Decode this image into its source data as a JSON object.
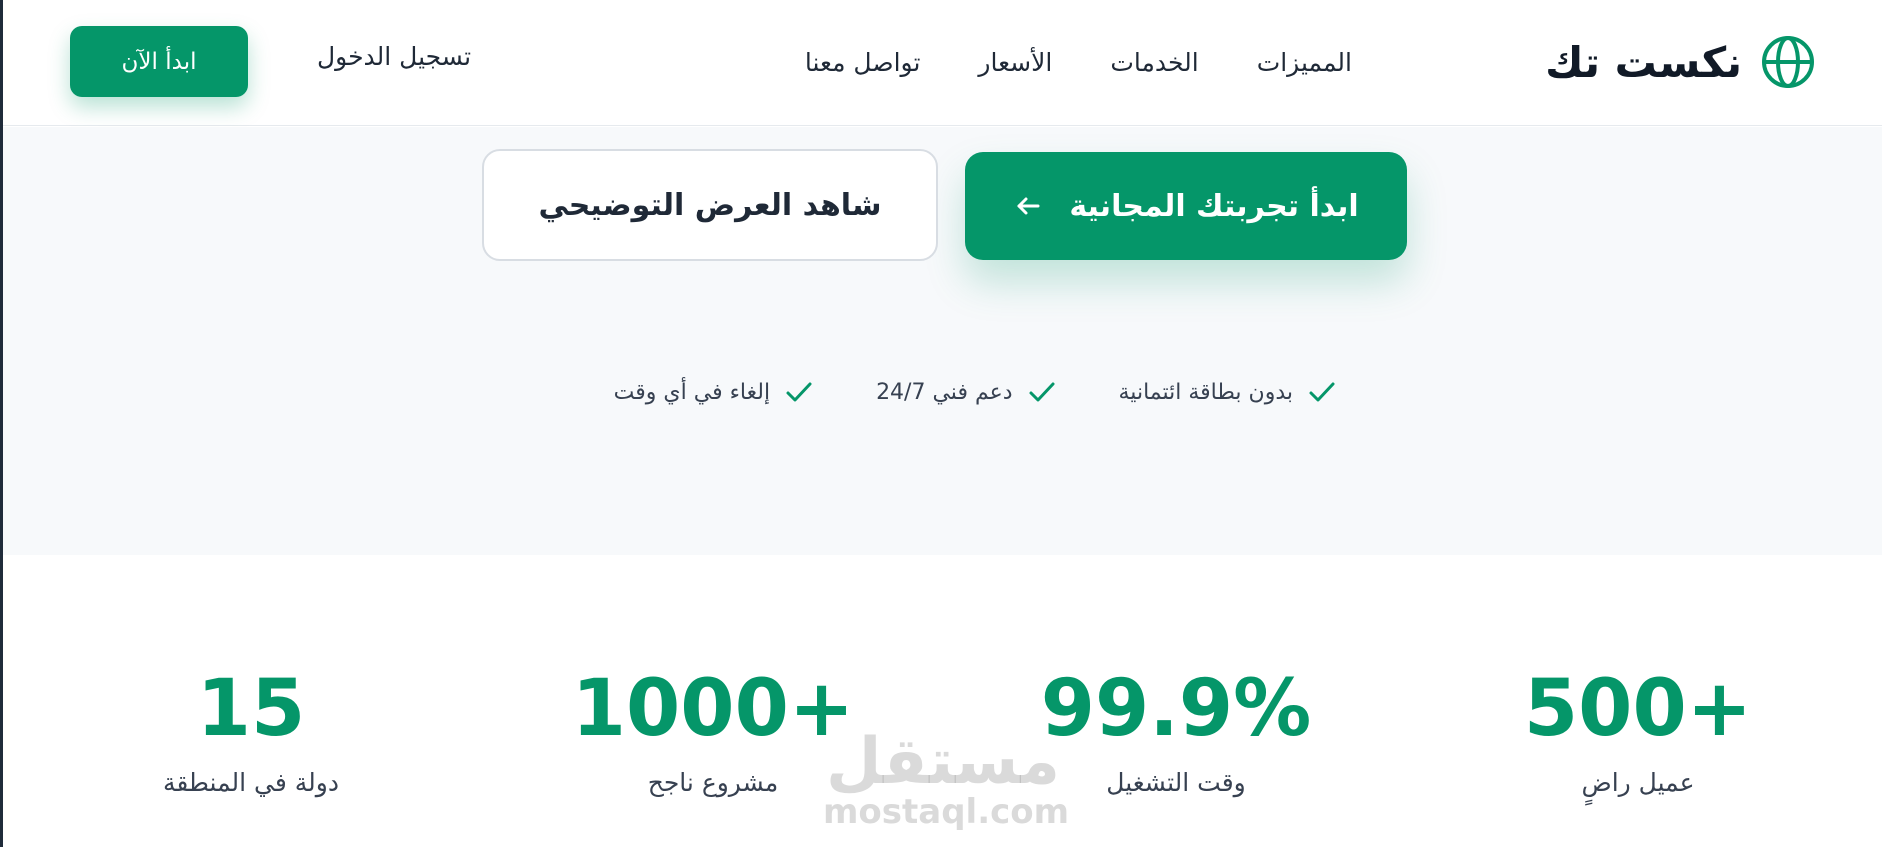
{
  "colors": {
    "accent": "#059669",
    "text_dark": "#111a27",
    "hero_bg": "#f7f9fb"
  },
  "header": {
    "brand_name": "نكست تك",
    "brand_icon": "globe-icon",
    "nav": [
      {
        "label": "المميزات"
      },
      {
        "label": "الخدمات"
      },
      {
        "label": "الأسعار"
      },
      {
        "label": "تواصل معنا"
      }
    ],
    "login_label": "تسجيل الدخول",
    "start_label": "ابدأ الآن"
  },
  "hero": {
    "cta_primary_label": "ابدأ تجربتك المجانية",
    "cta_primary_icon": "arrow-left-icon",
    "cta_secondary_label": "شاهد العرض التوضيحي",
    "features": [
      {
        "label": "بدون بطاقة ائتمانية",
        "icon": "check-icon"
      },
      {
        "label": "دعم فني 24/7",
        "icon": "check-icon"
      },
      {
        "label": "إلغاء في أي وقت",
        "icon": "check-icon"
      }
    ]
  },
  "stats": [
    {
      "value": "500+",
      "label": "عميل راضٍ"
    },
    {
      "value": "99.9%",
      "label": "وقت التشغيل"
    },
    {
      "value": "1000+",
      "label": "مشروع ناجح"
    },
    {
      "value": "15",
      "label": "دولة في المنطقة"
    }
  ],
  "watermark": {
    "arabic": "مستقل",
    "latin": "mostaql.com"
  }
}
